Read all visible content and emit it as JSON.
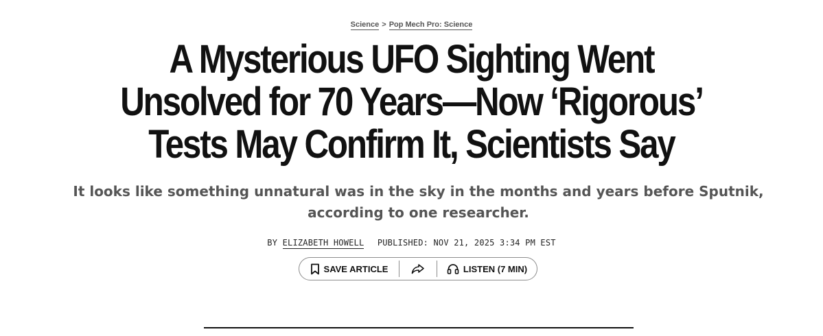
{
  "breadcrumb": {
    "items": [
      "Science",
      "Pop Mech Pro: Science"
    ],
    "separator": ">"
  },
  "article": {
    "title": "A Mysterious UFO Sighting Went Unsolved for 70 Years—Now ‘Rigorous’ Tests May Confirm It, Scientists Say",
    "subtitle": "It looks like something unnatural was in the sky in the months and years before Sputnik, according to one researcher.",
    "byline": {
      "by_label": "BY",
      "author": "ELIZABETH HOWELL",
      "published": "PUBLISHED: NOV 21, 2025 3:34 PM EST"
    }
  },
  "actions": {
    "save_label": "SAVE ARTICLE",
    "listen_label": "LISTEN (7 MIN)",
    "icons": {
      "save": "bookmark-icon",
      "share": "share-icon",
      "listen": "headphones-icon"
    }
  },
  "colors": {
    "text": "#111111",
    "muted": "#555555",
    "border": "#8c8c8c"
  }
}
